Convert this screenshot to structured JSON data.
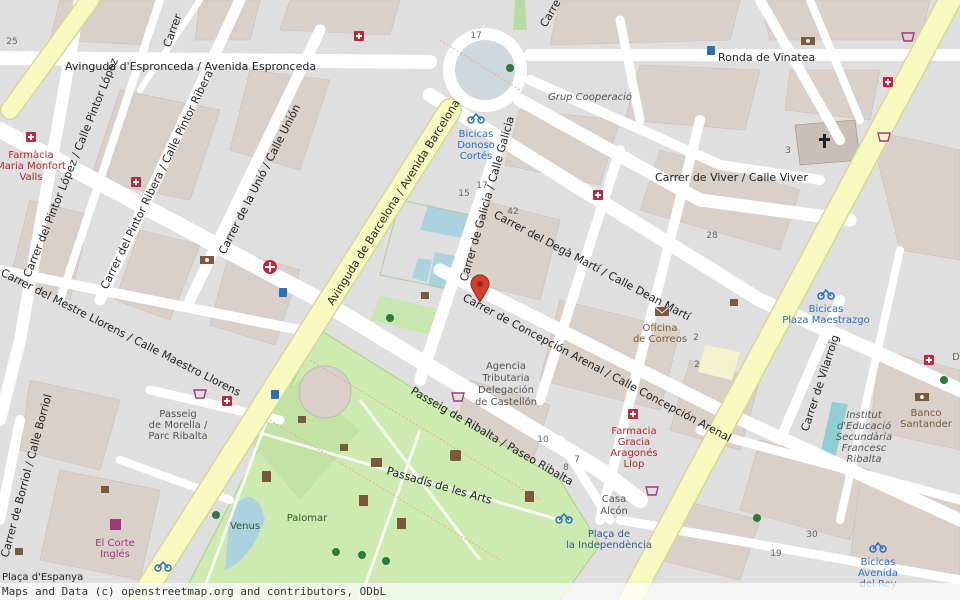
{
  "colors": {
    "road": "#ffffff",
    "primary": "#f7fabf",
    "building": "#d9d0c9",
    "land": "#e0dfdf",
    "park": "#cdebb0",
    "water": "#aad3df",
    "pin": "#d63e2a"
  },
  "streets": {
    "espronceda": "Avinguda d'Espronceda / Avenida Espronceda",
    "vinatea": "Ronda de Vinatea",
    "pintor_lopez": "Carrer del Pintor López / Calle Pintor López",
    "pintor_ribera": "Carrer del Pintor Ribera / Calle Pintor Ribera",
    "union": "Carrer de la Unió / Calle Unión",
    "barcelona": "Avinguda de Barcelona / Avenida Barcelona",
    "galicia": "Carrer de Galicia / Calle Galicia",
    "dega_marti": "Carrer del Degà Martí / Calle Dean Martí",
    "viver": "Carrer de Viver / Calle Viver",
    "concepcion": "Carrer de Concepción Arenal / Calle Concepción Arenal",
    "llorens": "Carrer del Mestre Llorens / Calle Maestro Llorens",
    "ribalta": "Passeig de Ribalta / Paseo Ribalta",
    "arts": "Passadís de les Arts",
    "borriol": "Carrer de Borriol / Calle Borriol",
    "vilarroig": "Carrer de Vilarroig",
    "carrer_top": "Carrer",
    "carrer_top2": "Carre"
  },
  "pois": {
    "farmacia_monfort": [
      "Farmàcia",
      "Maria Monfort",
      "Valls"
    ],
    "bicicas_donoso": [
      "Bicicas",
      "Donoso",
      "Cortés"
    ],
    "grup_cooperacio": "Grup Cooperació",
    "oficina_correos": [
      "Oficina",
      "de Correos"
    ],
    "agencia": [
      "Agencia",
      "Tributaria",
      "Delegación",
      "de Castellón"
    ],
    "bicicas_maestrazgo": [
      "Bicicas",
      "Plaza Maestrazgo"
    ],
    "farmacia_gracia": [
      "Farmacia",
      "Gracia",
      "Aragonés",
      "Llop"
    ],
    "instituto": [
      "Institut",
      "d'Educació",
      "Secundària",
      "Francesc",
      "Ribalta"
    ],
    "banco": [
      "Banco",
      "Santander"
    ],
    "passeig_morella": [
      "Passeig",
      "de Morella /",
      "Parc Ribalta"
    ],
    "venus": "Venus",
    "palomar": "Palomar",
    "corte_ingles": [
      "El Corte",
      "Inglés"
    ],
    "casa_alcon": [
      "Casa",
      "Alcón"
    ],
    "placa_independencia": [
      "Plaça de",
      "la Independència"
    ],
    "placa_espanya": "Plaça d'Espanya",
    "bicicas_rey": [
      "Bicicas",
      "Avenida",
      "del Rey"
    ],
    "d_cut": "D"
  },
  "numbers": [
    "25",
    "17",
    "15",
    "17",
    "42",
    "28",
    "3",
    "2",
    "10",
    "8",
    "7",
    "30",
    "19",
    "2"
  ],
  "attribution": "Maps and Data (c) openstreetmap.org and contributors, ODbL",
  "marker": {
    "label": "location-pin"
  }
}
